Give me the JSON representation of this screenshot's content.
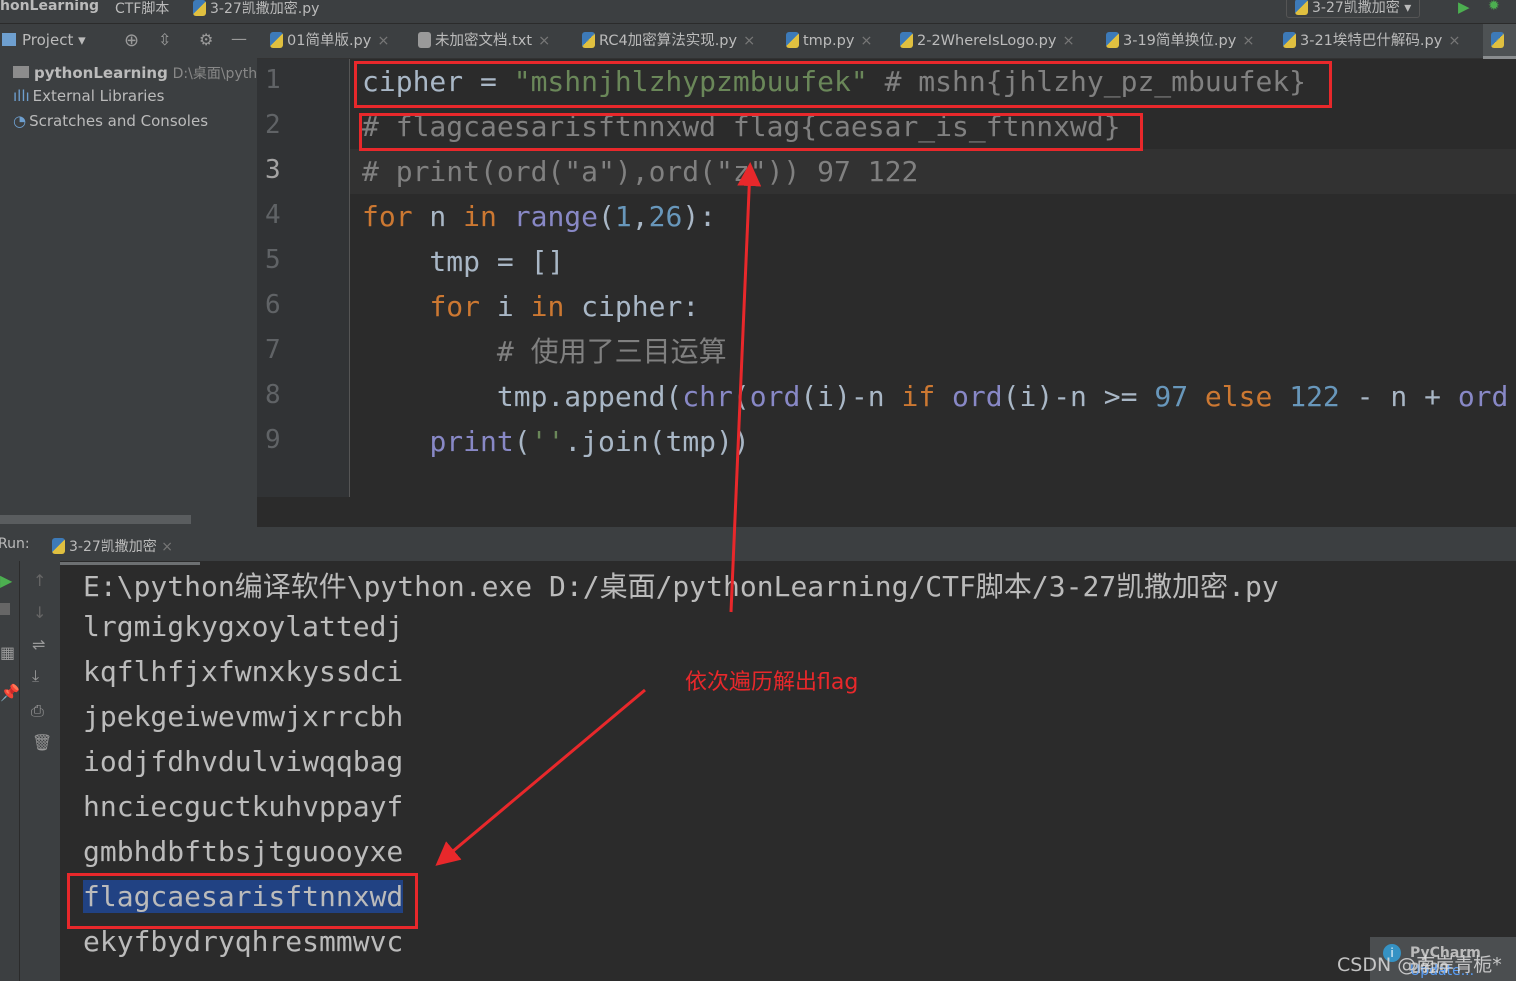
{
  "breadcrumb": [
    "honLearning",
    "CTF脚本",
    "3-27凯撒加密.py"
  ],
  "run_config": "3-27凯撒加密",
  "project_panel": {
    "label": "Project",
    "items": [
      {
        "label": "pythonLearning",
        "path": "D:\\桌面\\pytho"
      },
      {
        "label": "External Libraries"
      },
      {
        "label": "Scratches and Consoles"
      }
    ]
  },
  "tabs": [
    {
      "label": "01简单版.py",
      "icon": "python-file-icon"
    },
    {
      "label": "未加密文档.txt",
      "icon": "text-file-icon"
    },
    {
      "label": "RC4加密算法实现.py",
      "icon": "python-file-icon"
    },
    {
      "label": "tmp.py",
      "icon": "python-file-icon"
    },
    {
      "label": "2-2WhereIsLogo.py",
      "icon": "python-file-icon"
    },
    {
      "label": "3-19简单换位.py",
      "icon": "python-file-icon"
    },
    {
      "label": "3-21埃特巴什解码.py",
      "icon": "python-file-icon"
    }
  ],
  "colors": {
    "keyword": "#cc7832",
    "string": "#6a8759",
    "comment": "#808080",
    "number": "#6897bb",
    "builtin": "#8888c6",
    "text": "#a9b7c6",
    "annotation": "#e8282b",
    "selection": "#214283"
  },
  "code_lines": [
    [
      [
        "cipher = ",
        "t"
      ],
      [
        "\"mshnjhlzhypzmbuufek\"",
        "s"
      ],
      [
        " # mshn{jhlzhy_pz_mbuufek}",
        "c"
      ]
    ],
    [
      [
        "# flagcaesarisftnnxwd flag{caesar_is_ftnnxwd}",
        "c"
      ]
    ],
    [
      [
        "# print(ord(\"a\"),ord(\"z\")) 97 122",
        "c"
      ]
    ],
    [
      [
        "for",
        "k"
      ],
      [
        " n ",
        "t"
      ],
      [
        "in",
        "k"
      ],
      [
        " ",
        "t"
      ],
      [
        "range",
        "b"
      ],
      [
        "(",
        "t"
      ],
      [
        "1",
        "n"
      ],
      [
        ",",
        "t"
      ],
      [
        "26",
        "n"
      ],
      [
        "):",
        "t"
      ]
    ],
    [
      [
        "    tmp = []",
        "t"
      ]
    ],
    [
      [
        "    ",
        "t"
      ],
      [
        "for",
        "k"
      ],
      [
        " i ",
        "t"
      ],
      [
        "in",
        "k"
      ],
      [
        " cipher:",
        "t"
      ]
    ],
    [
      [
        "        # 使用了三目运算",
        "c"
      ]
    ],
    [
      [
        "        tmp.append(",
        "t"
      ],
      [
        "chr",
        "b"
      ],
      [
        "(",
        "t"
      ],
      [
        "ord",
        "b"
      ],
      [
        "(i)-n ",
        "t"
      ],
      [
        "if",
        "k"
      ],
      [
        " ",
        "t"
      ],
      [
        "ord",
        "b"
      ],
      [
        "(i)-n >= ",
        "t"
      ],
      [
        "97",
        "n"
      ],
      [
        " ",
        "t"
      ],
      [
        "else",
        "k"
      ],
      [
        " ",
        "t"
      ],
      [
        "122",
        "n"
      ],
      [
        " - n + ",
        "t"
      ],
      [
        "ord",
        "b"
      ]
    ],
    [
      [
        "    ",
        "t"
      ],
      [
        "print",
        "b"
      ],
      [
        "(",
        "t"
      ],
      [
        "''",
        "s"
      ],
      [
        ".join(tmp))",
        "t"
      ]
    ]
  ],
  "run": {
    "label": "Run:",
    "tab": "3-27凯撒加密",
    "output": [
      "E:\\python编译软件\\python.exe D:/桌面/pythonLearning/CTF脚本/3-27凯撒加密.py",
      "lrgmigkygxoylattedj",
      "kqflhfjxfwnxkyssdci",
      "jpekgeiwevmwjxrrcbh",
      "iodjfdhvdulviwqqbag",
      "hnciecguctkuhvppayf",
      "gmbhdbftbsjtguooyxe",
      "flagcaesarisftnnxwd",
      "ekyfbydryqhresmmwvc"
    ]
  },
  "annotation": "依次遍历解出flag",
  "notification": {
    "title": "PyCharm 2020",
    "link": "Update..."
  },
  "watermark": "CSDN @南岸青栀*"
}
